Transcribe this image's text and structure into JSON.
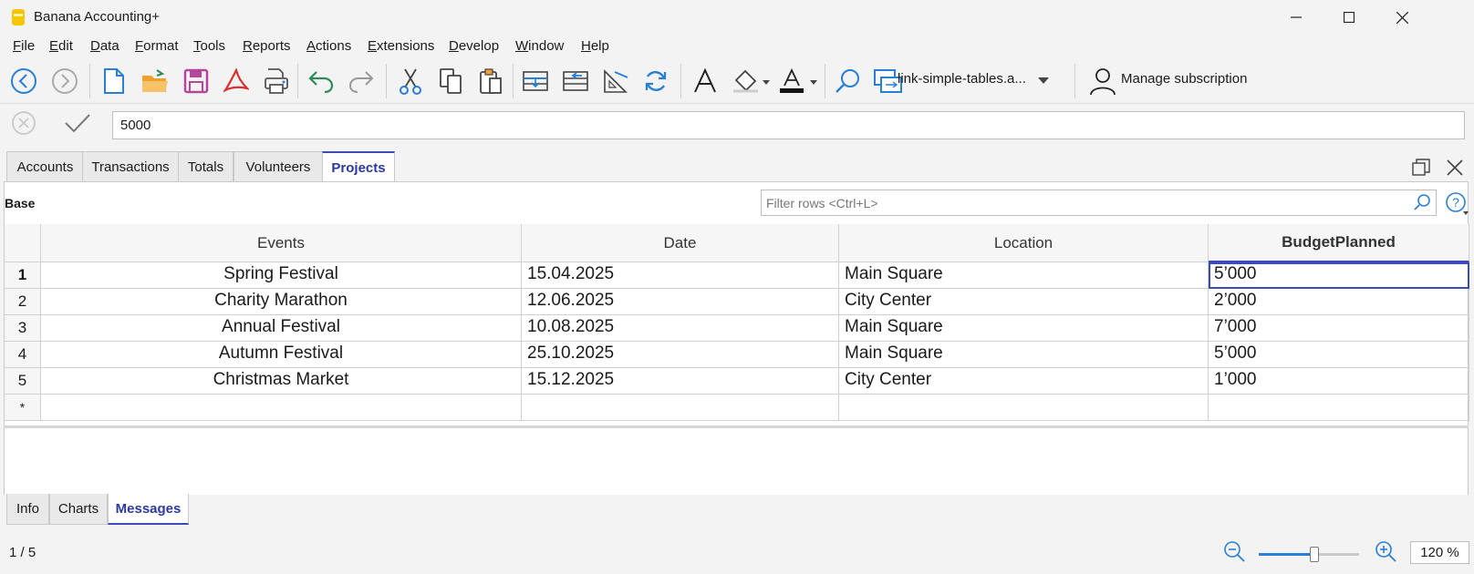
{
  "window": {
    "title": "Banana Accounting+"
  },
  "menu": [
    {
      "u": "F",
      "rest": "ile"
    },
    {
      "u": "E",
      "rest": "dit"
    },
    {
      "u": "D",
      "rest": "ata"
    },
    {
      "u": "F",
      "rest": "ormat"
    },
    {
      "u": "T",
      "rest": "ools"
    },
    {
      "u": "R",
      "rest": "eports"
    },
    {
      "u": "A",
      "rest": "ctions"
    },
    {
      "u": "E",
      "rest": "xtensions"
    },
    {
      "u": "D",
      "rest": "evelop"
    },
    {
      "u": "W",
      "rest": "indow"
    },
    {
      "u": "H",
      "rest": "elp"
    }
  ],
  "toolbar": {
    "file_combo": "link-simple-tables.a...",
    "manage_subscription": "Manage subscription"
  },
  "formula": {
    "value": "5000"
  },
  "tabs": [
    "Accounts",
    "Transactions",
    "Totals",
    "Volunteers",
    "Projects"
  ],
  "active_tab": "Projects",
  "view": {
    "label": "Base",
    "filter_placeholder": "Filter rows <Ctrl+L>"
  },
  "table": {
    "columns": [
      "Events",
      "Date",
      "Location",
      "BudgetPlanned"
    ],
    "rows": [
      {
        "n": "1",
        "event": "Spring Festival",
        "date": "15.04.2025",
        "location": "Main Square",
        "budget": "5’000"
      },
      {
        "n": "2",
        "event": "Charity Marathon",
        "date": "12.06.2025",
        "location": "City Center",
        "budget": "2’000"
      },
      {
        "n": "3",
        "event": "Annual Festival",
        "date": "10.08.2025",
        "location": "Main Square",
        "budget": "7’000"
      },
      {
        "n": "4",
        "event": "Autumn Festival",
        "date": "25.10.2025",
        "location": "Main Square",
        "budget": "5’000"
      },
      {
        "n": "5",
        "event": "Christmas Market",
        "date": "15.12.2025",
        "location": "City Center",
        "budget": "1’000"
      }
    ],
    "new_row_marker": "*"
  },
  "bottom_tabs": [
    "Info",
    "Charts",
    "Messages"
  ],
  "active_bottom_tab": "Messages",
  "status": {
    "position": "1 / 5",
    "zoom": "120 %",
    "zoom_slider_fraction": 0.55
  },
  "colors": {
    "accent": "#3b4db5",
    "undo_green": "#2e8b57",
    "folder_orange": "#f0a030",
    "save_magenta": "#b5479b",
    "pdf_red": "#d9302c",
    "icon_blue": "#2a7fd4"
  }
}
